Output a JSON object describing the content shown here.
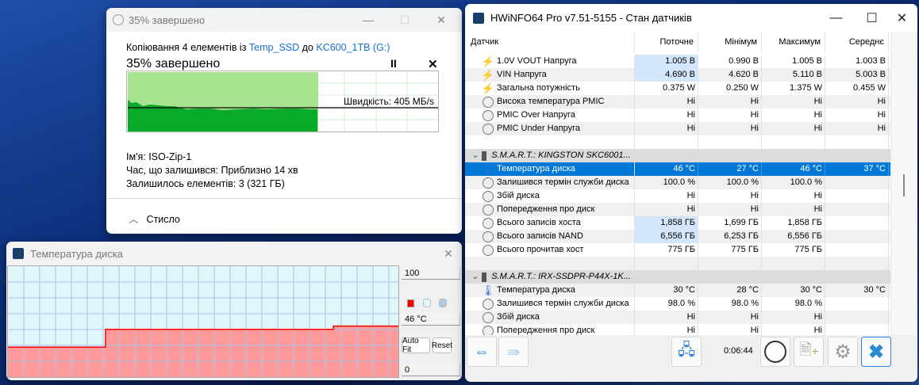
{
  "copy": {
    "title": "35% завершено",
    "line_pre": "Копіювання 4 елементів із ",
    "source": "Temp_SSD",
    "line_mid": " до ",
    "dest": "KC600_1TB (G:)",
    "progress_label": "35% завершено",
    "progress_percent": 35,
    "speed": "Швидкість: 405 МБ/s",
    "name_label": "Ім'я:",
    "name_value": "ISO-Zip-1",
    "time_label": "Час, що залишився:",
    "time_value": "Приблизно 14 хв",
    "items_label": "Залишилось елементів:",
    "items_value": "3 (321 ГБ)",
    "details_toggle": "Стисло"
  },
  "temp": {
    "title": "Температура диска",
    "max": "100",
    "current": "46 °C",
    "min": "0",
    "auto_fit": "Auto Fit",
    "reset": "Reset",
    "series": [
      27,
      27,
      27,
      27,
      27,
      27,
      43,
      43,
      43,
      43,
      43,
      43,
      43,
      43,
      43,
      43,
      43,
      43,
      43,
      43,
      46,
      46,
      46,
      46
    ],
    "colors": {
      "line": "#ff0000",
      "fill": "#ff9a9a",
      "bg": "#e0f6fc",
      "grid": "#a8c4ea"
    }
  },
  "hw": {
    "title": "HWiNFO64 Pro v7.51-5155 - Стан датчиків",
    "columns": [
      "Датчик",
      "Поточне",
      "Мінімум",
      "Максимум",
      "Середнє"
    ],
    "rows": [
      {
        "type": "item",
        "icon": "bolt",
        "name": "1.0V VOUT Напруга",
        "v": [
          "1.005 В",
          "0.990 В",
          "1.005 В",
          "1.003 В"
        ],
        "hl": true
      },
      {
        "type": "item",
        "icon": "bolt",
        "name": "VIN Напруга",
        "v": [
          "4.690 В",
          "4.620 В",
          "5.110 В",
          "5.003 В"
        ],
        "hl": true
      },
      {
        "type": "item",
        "icon": "bolt",
        "name": "Загальна потужність",
        "v": [
          "0.375 W",
          "0.250 W",
          "1.375 W",
          "0.455 W"
        ]
      },
      {
        "type": "item",
        "icon": "gauge",
        "name": "Висока температура PMIC",
        "v": [
          "Ні",
          "Ні",
          "Ні",
          "Ні"
        ]
      },
      {
        "type": "item",
        "icon": "gauge",
        "name": "PMIC Over Напруга",
        "v": [
          "Ні",
          "Ні",
          "Ні",
          "Ні"
        ]
      },
      {
        "type": "item",
        "icon": "gauge",
        "name": "PMIC Under Напруга",
        "v": [
          "Ні",
          "Ні",
          "Ні",
          "Ні"
        ]
      },
      {
        "type": "blank"
      },
      {
        "type": "group",
        "name": "S.M.A.R.T.: KINGSTON SKC6001..."
      },
      {
        "type": "item",
        "icon": "thermo",
        "name": "Температура диска",
        "v": [
          "46 °C",
          "27 °C",
          "46 °C",
          "37 °C"
        ],
        "sel": true
      },
      {
        "type": "item",
        "icon": "gauge",
        "name": "Залишився термін служби диска",
        "v": [
          "100.0 %",
          "100.0 %",
          "100.0 %",
          ""
        ]
      },
      {
        "type": "item",
        "icon": "gauge",
        "name": "Збій диска",
        "v": [
          "Ні",
          "Ні",
          "Ні",
          ""
        ]
      },
      {
        "type": "item",
        "icon": "gauge",
        "name": "Попередження про диск",
        "v": [
          "Ні",
          "Ні",
          "Ні",
          ""
        ]
      },
      {
        "type": "item",
        "icon": "gauge",
        "name": "Всього записів хоста",
        "v": [
          "1,858 ГБ",
          "1,699 ГБ",
          "1,858 ГБ",
          ""
        ],
        "hl": true
      },
      {
        "type": "item",
        "icon": "gauge",
        "name": "Всього записів NAND",
        "v": [
          "6,556 ГБ",
          "6,253 ГБ",
          "6,556 ГБ",
          ""
        ],
        "hl": true
      },
      {
        "type": "item",
        "icon": "gauge",
        "name": "Всього прочитав хост",
        "v": [
          "775 ГБ",
          "775 ГБ",
          "775 ГБ",
          ""
        ]
      },
      {
        "type": "blank"
      },
      {
        "type": "group",
        "name": "S.M.A.R.T.: IRX-SSDPR-P44X-1K..."
      },
      {
        "type": "item",
        "icon": "thermo",
        "name": "Температура диска",
        "v": [
          "30 °C",
          "28 °C",
          "30 °C",
          "30 °C"
        ]
      },
      {
        "type": "item",
        "icon": "gauge",
        "name": "Залишився термін служби диска",
        "v": [
          "98.0 %",
          "98.0 %",
          "98.0 %",
          ""
        ]
      },
      {
        "type": "item",
        "icon": "gauge",
        "name": "Збій диска",
        "v": [
          "Ні",
          "Ні",
          "Ні",
          ""
        ]
      },
      {
        "type": "item",
        "icon": "gauge",
        "name": "Попередження про диск",
        "v": [
          "Ні",
          "Ні",
          "Ні",
          ""
        ]
      }
    ],
    "timer": "0:06:44"
  }
}
